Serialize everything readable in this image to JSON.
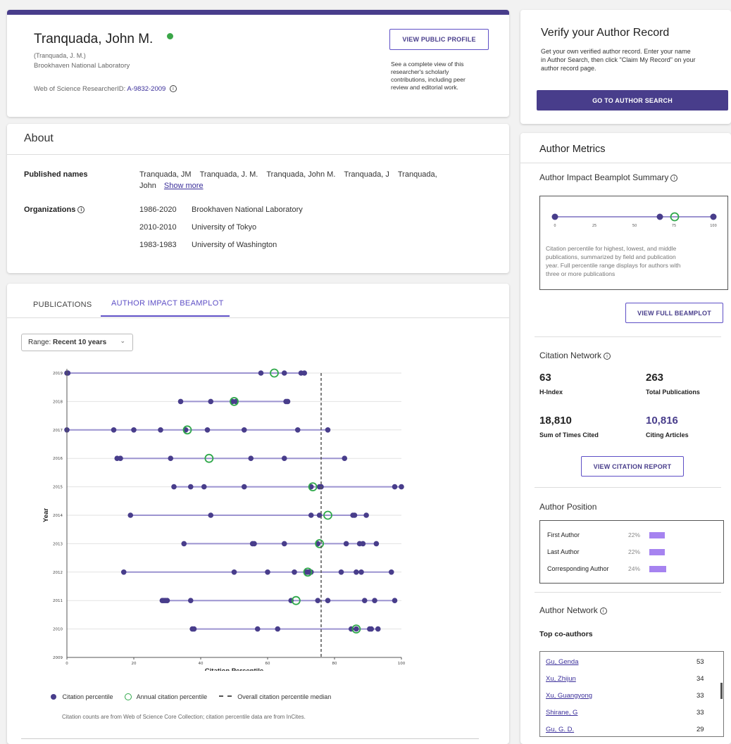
{
  "profile": {
    "name": "Tranquada, John M.",
    "alt_name": "(Tranquada, J. M.)",
    "org": "Brookhaven National Laboratory",
    "rid_label": "Web of Science ResearcherID:",
    "rid_value": "A-9832-2009",
    "public_btn": "VIEW PUBLIC PROFILE",
    "public_desc": [
      "See a complete view of this",
      "researcher's scholarly",
      "contributions, including peer",
      "review and editorial work."
    ]
  },
  "about": {
    "title": "About",
    "published_label": "Published names",
    "names_line1": "Tranquada, JM    Tranquada, J. M.    Tranquada, John M.    Tranquada, J    Tranquada,",
    "names_line2": "John",
    "show_more": "Show more",
    "org_label": "Organizations",
    "orgs": [
      {
        "years": "1986-2020",
        "name": "Brookhaven National Laboratory"
      },
      {
        "years": "2010-2010",
        "name": "University of Tokyo"
      },
      {
        "years": "1983-1983",
        "name": "University of Washington"
      }
    ]
  },
  "tabs": {
    "publications": "PUBLICATIONS",
    "beamplot": "AUTHOR IMPACT BEAMPLOT"
  },
  "range": {
    "label": "Range:",
    "value": "Recent 10 years"
  },
  "legend": {
    "citation": "Citation percentile",
    "annual": "Annual citation percentile",
    "median": "Overall citation percentile median",
    "footnote": "Citation counts are from Web of Science Core Collection; citation percentile data are from InCites."
  },
  "chart_data": {
    "type": "scatter",
    "xlabel": "Citation Percentile",
    "ylabel": "Year",
    "xlim": [
      0,
      100
    ],
    "xticks": [
      0,
      20,
      40,
      60,
      80,
      100
    ],
    "median": 76,
    "colors": {
      "point": "#483d8b",
      "annual": "#2fa84a",
      "range": "#9c93d0",
      "median": "#555555"
    },
    "years": [
      {
        "year": "2019",
        "points": [
          0,
          0.3,
          58,
          65,
          70,
          71
        ],
        "annual": 62
      },
      {
        "year": "2018",
        "points": [
          34,
          43,
          49.5,
          50.5,
          65.5,
          66
        ],
        "annual": 50
      },
      {
        "year": "2017",
        "points": [
          0,
          14,
          20,
          28,
          35.5,
          42,
          53,
          69,
          78
        ],
        "annual": 36
      },
      {
        "year": "2016",
        "points": [
          15,
          16,
          31,
          55,
          65,
          83
        ],
        "annual": 42.5
      },
      {
        "year": "2015",
        "points": [
          32,
          37,
          41,
          53,
          73,
          75.5,
          76,
          98,
          100
        ],
        "annual": 73.5
      },
      {
        "year": "2014",
        "points": [
          19,
          43,
          73,
          75.5,
          85.5,
          86,
          89.5
        ],
        "annual": 78
      },
      {
        "year": "2013",
        "points": [
          35,
          55.5,
          56,
          65,
          75,
          83.5,
          87.5,
          88.5,
          92.5
        ],
        "annual": 75.5
      },
      {
        "year": "2012",
        "points": [
          17,
          50,
          60,
          68,
          71.5,
          72,
          72.5,
          73,
          82,
          86.5,
          88,
          97
        ],
        "annual": 72
      },
      {
        "year": "2011",
        "points": [
          28.5,
          29,
          29.5,
          30,
          37,
          67,
          75,
          78,
          89,
          92,
          98
        ],
        "annual": 68.5
      },
      {
        "year": "2010",
        "points": [
          37.5,
          38,
          57,
          63,
          85,
          86.5,
          90.5,
          91,
          93
        ],
        "annual": 86.5
      },
      {
        "year": "2009",
        "points": []
      }
    ]
  },
  "verify": {
    "title": "Verify your Author Record",
    "desc": [
      "Get your own verified author record. Enter your name",
      "in Author Search, then click \"Claim My Record\" on your",
      "author record page."
    ],
    "btn": "GO TO AUTHOR SEARCH"
  },
  "metrics": {
    "title": "Author Metrics",
    "beamplot_summary": "Author Impact Beamplot Summary",
    "summary_ticks": [
      "0",
      "25",
      "50",
      "75",
      "100"
    ],
    "summary_desc": [
      "Citation percentile for highest, lowest, and middle",
      "publications, summarized by field and publication",
      "year. Full percentile range displays for authors with",
      "three or more publications"
    ],
    "full_btn": "VIEW FULL BEAMPLOT",
    "network_title": "Citation Network",
    "h_index": "63",
    "h_index_label": "H-Index",
    "total_pubs": "263",
    "total_pubs_label": "Total Publications",
    "times_cited": "18,810",
    "times_cited_label": "Sum of Times Cited",
    "citing": "10,816",
    "citing_label": "Citing Articles",
    "report_btn": "VIEW CITATION REPORT",
    "position_title": "Author Position",
    "positions": [
      {
        "label": "First Author",
        "pct": "22%",
        "value": 22
      },
      {
        "label": "Last Author",
        "pct": "22%",
        "value": 22
      },
      {
        "label": "Corresponding Author",
        "pct": "24%",
        "value": 24
      }
    ],
    "author_network": "Author Network",
    "top_coauthors": "Top co-authors",
    "coauthors": [
      {
        "name": "Gu, Genda",
        "count": "53"
      },
      {
        "name": "Xu, Zhijun",
        "count": "34"
      },
      {
        "name": "Xu, Guangyong",
        "count": "33"
      },
      {
        "name": "Shirane, G",
        "count": "33"
      },
      {
        "name": "Gu, G. D.",
        "count": "29"
      }
    ]
  }
}
